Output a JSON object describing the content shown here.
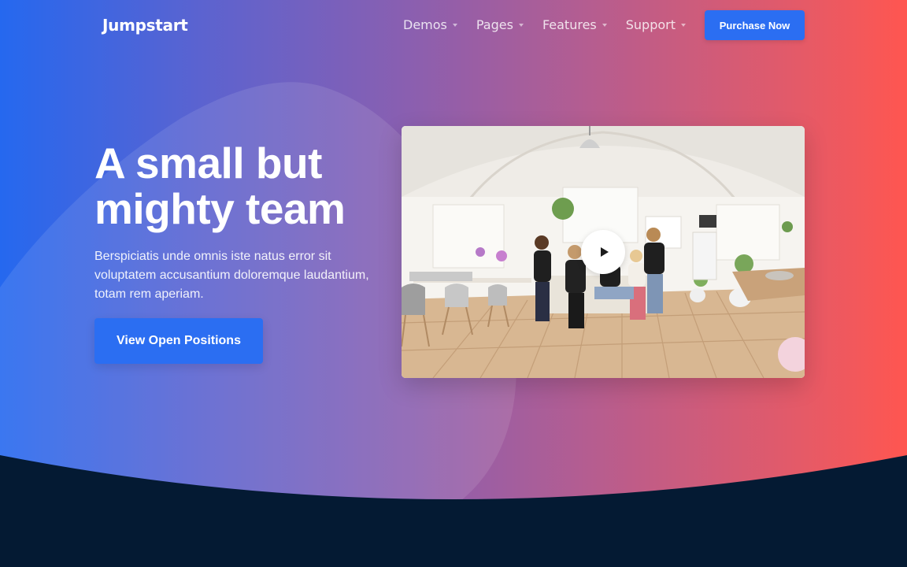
{
  "nav": {
    "logo": "Jumpstart",
    "menu": [
      {
        "label": "Demos"
      },
      {
        "label": "Pages"
      },
      {
        "label": "Features"
      },
      {
        "label": "Support"
      }
    ],
    "purchase_label": "Purchase Now"
  },
  "hero": {
    "headline": "A small but mighty team",
    "lead": "Berspiciatis unde omnis iste natus error sit voluptatem accusantium doloremque laudantium, totam rem aperiam.",
    "cta_label": "View Open Positions"
  },
  "video": {
    "play_icon": "play-icon",
    "image_subject": "team-photo"
  },
  "colors": {
    "gradient_start": "#2568ef",
    "gradient_end": "#ff5650",
    "button_blue": "#2b6ef2",
    "footer_navy": "#041a33"
  }
}
